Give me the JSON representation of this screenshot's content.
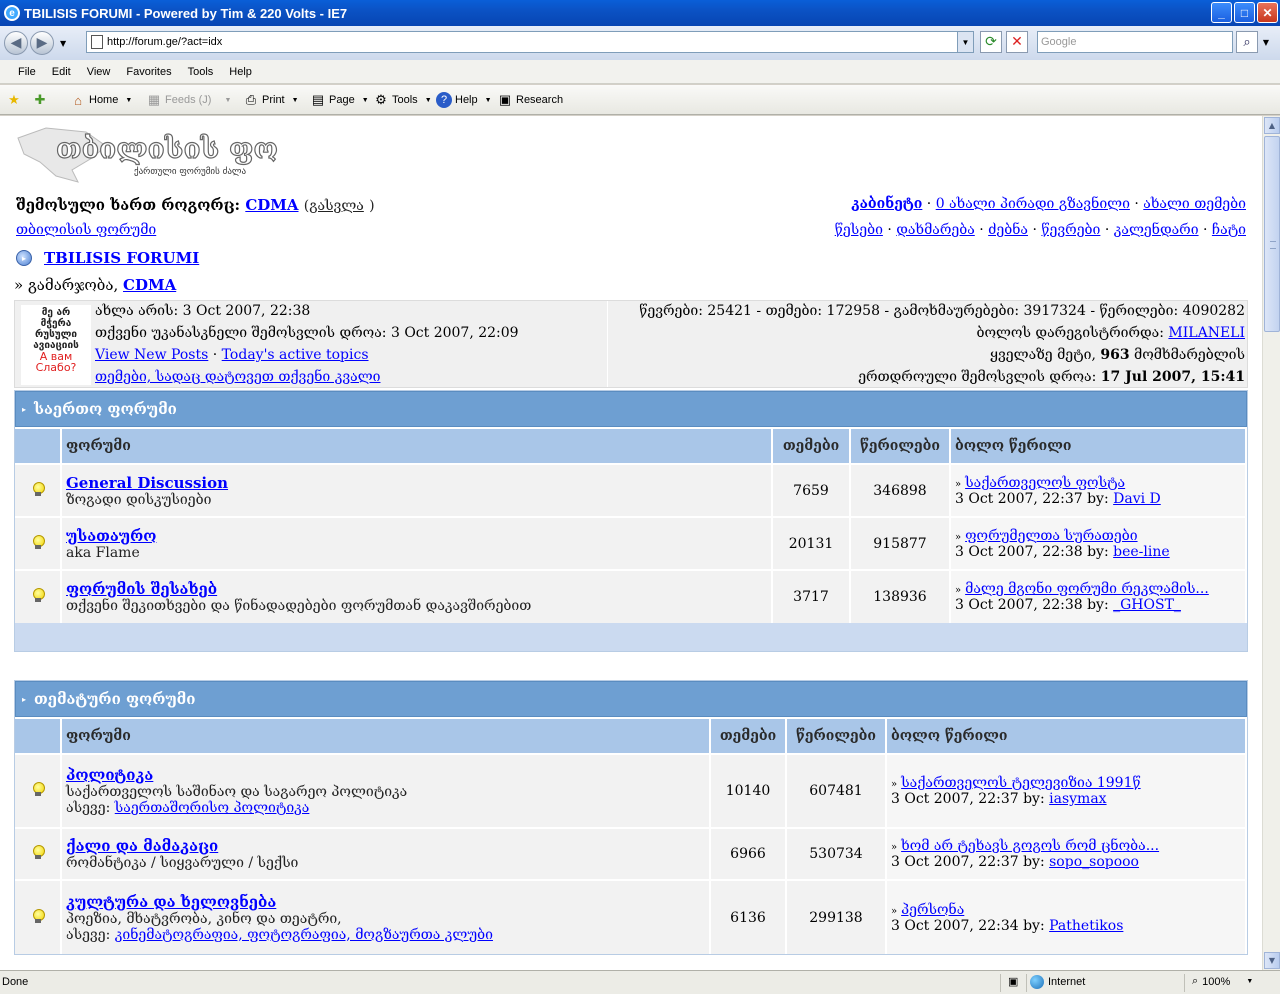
{
  "window": {
    "title": "TBILISIS FORUMI - Powered by Tim & 220 Volts - IE7"
  },
  "browser": {
    "url": "http://forum.ge/?act=idx",
    "search_placeholder": "Google",
    "menu": [
      "File",
      "Edit",
      "View",
      "Favorites",
      "Tools",
      "Help"
    ],
    "toolbar": {
      "home": "Home",
      "feeds": "Feeds (J)",
      "print": "Print",
      "page": "Page",
      "tools": "Tools",
      "help": "Help",
      "research": "Research"
    },
    "status": {
      "text": "Done",
      "zone": "Internet",
      "zoom": "100%"
    }
  },
  "header": {
    "logo_title": "თბილისის ფორუმი",
    "logo_sub": "ქართული ფორუმის ძალა",
    "logged_in_label": "შემოსული ხართ როგორც:",
    "username": "CDMA",
    "logout_open": "(",
    "logout": "გასვლა",
    "logout_close": ")",
    "forum_home": "თბილისის ფორუმი",
    "cabinet": "კაბინეტი",
    "new_pm": "0 ახალი პირადი გზავნილი",
    "new_topics": "ახალი თემები",
    "rules": "წესები",
    "help": "დახმარება",
    "search": "ძებნა",
    "members": "წევრები",
    "calendar": "კალენდარი",
    "chat": "ჩატი",
    "forum_title": "TBILISIS FORUMI",
    "greeting": "გამარჯობა,",
    "greeting_user": "CDMA"
  },
  "info": {
    "img_lines": [
      "მე არ",
      "მჭერა",
      "რუსული",
      "ავიაციის",
      "А вам",
      "Слабо?"
    ],
    "now": "ახლა არის: 3 Oct 2007, 22:38",
    "last_visit": "თქვენი უკანასკნელი შემოსვლის დროა: 3 Oct 2007, 22:09",
    "view_new": "View New Posts",
    "todays": "Today's active topics",
    "my_topics": "თემები, სადაც დატოვეთ თქვენი კვალი",
    "stats": "წევრები: 25421 - თემები: 172958 - გამოხმაურებები: 3917324 - წერილები: 4090282",
    "last_reg_label": "ბოლოს დარეგისტრირდა:",
    "last_reg_user": "MILANELI",
    "most_label": "ყველაზე მეტი,",
    "most_count": "963",
    "most_suffix": "მომხმარებლის",
    "online_label": "ერთდროული შემოსვლის დროა:",
    "online_date": "17 Jul 2007, 15:41"
  },
  "categories": [
    {
      "title": "საერთო ფორუმი",
      "headers": {
        "forum": "ფორუმი",
        "topics": "თემები",
        "posts": "წერილები",
        "last": "ბოლო წერილი"
      },
      "rows": [
        {
          "name": "General Discussion",
          "desc": "ზოგადი დისკუსიები",
          "topics": "7659",
          "posts": "346898",
          "last_topic": "საქართველოს ფოსტა",
          "last_date": "3 Oct 2007, 22:37 by:",
          "last_user": "Davi D"
        },
        {
          "name": "უსათაურო",
          "desc": "aka Flame",
          "topics": "20131",
          "posts": "915877",
          "last_topic": "ფორუმელთა სურათები",
          "last_date": "3 Oct 2007, 22:38 by:",
          "last_user": "bee-line"
        },
        {
          "name": "ფორუმის შესახებ",
          "desc": "თქვენი შეკითხვები და წინადადებები ფორუმთან დაკავშირებით",
          "topics": "3717",
          "posts": "138936",
          "last_topic": "მალე მგონი ფორუმი რეკლამის...",
          "last_date": "3 Oct 2007, 22:38 by:",
          "last_user": "_GHOST_"
        }
      ]
    },
    {
      "title": "თემატური ფორუმი",
      "headers": {
        "forum": "ფორუმი",
        "topics": "თემები",
        "posts": "წერილები",
        "last": "ბოლო წერილი"
      },
      "rows": [
        {
          "name": "პოლიტიკა",
          "desc": "საქართველოს საშინაო და საგარეო პოლიტიკა",
          "sub_label": "ასევე:",
          "sub_links": "საერთაშორისო პოლიტიკა",
          "topics": "10140",
          "posts": "607481",
          "last_topic": "საქართველოს ტელევიზია 1991წ",
          "last_date": "3 Oct 2007, 22:37 by:",
          "last_user": "iasymax"
        },
        {
          "name": "ქალი და მამაკაცი",
          "desc": "რომანტიკა / სიყვარული / სექსი",
          "topics": "6966",
          "posts": "530734",
          "last_topic": "ხომ არ ტეხავს გოგოს რომ ცნობა...",
          "last_date": "3 Oct 2007, 22:37 by:",
          "last_user": "sopo_sopooo"
        },
        {
          "name": "კულტურა და ხელოვნება",
          "desc": "პოეზია, მხატვრობა, კინო და თეატრი,",
          "sub_label": "ასევე:",
          "sub_links": "კინემატოგრაფია, ფოტოგრაფია, მოგზაურთა კლუბი",
          "topics": "6136",
          "posts": "299138",
          "last_topic": "პერსონა",
          "last_date": "3 Oct 2007, 22:34 by:",
          "last_user": "Pathetikos"
        }
      ]
    }
  ]
}
